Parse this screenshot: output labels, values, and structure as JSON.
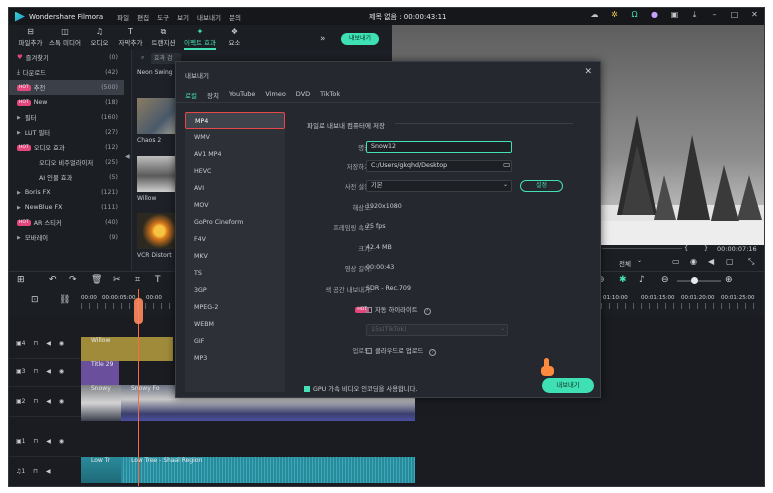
{
  "app": {
    "name": "Wondershare Filmora",
    "menu": [
      "파일",
      "편집",
      "도구",
      "보기",
      "내보내기",
      "문의"
    ],
    "project_title": "제목 없음 : 00:00:43:11"
  },
  "toolbar": {
    "items": [
      {
        "label": "파일추가",
        "icon": "import-icon"
      },
      {
        "label": "스톡 미디어",
        "icon": "stock-media-icon"
      },
      {
        "label": "오디오",
        "icon": "audio-icon"
      },
      {
        "label": "자막추가",
        "icon": "title-icon"
      },
      {
        "label": "트랜지션",
        "icon": "transition-icon"
      },
      {
        "label": "이펙트 효과",
        "icon": "effects-icon"
      },
      {
        "label": "요소",
        "icon": "elements-icon"
      }
    ],
    "export_label": "내보내기"
  },
  "library": {
    "items": [
      {
        "label": "즐겨찾기",
        "count": "(0)"
      },
      {
        "label": "다운로드",
        "count": "(42)"
      },
      {
        "label": "추천",
        "count": "(500)",
        "badge": "HOT",
        "selected": true
      },
      {
        "label": "New",
        "count": "(18)",
        "badge": "HOT"
      },
      {
        "label": "필터",
        "count": "(160)"
      },
      {
        "label": "LUT 필터",
        "count": "(27)"
      },
      {
        "label": "오디오 효과",
        "count": "(12)",
        "badge": "HOT"
      },
      {
        "label": "오디오 비주얼라이저",
        "count": "(25)"
      },
      {
        "label": "AI 인물 효과",
        "count": "(5)"
      },
      {
        "label": "Boris FX",
        "count": "(121)"
      },
      {
        "label": "NewBlue FX",
        "count": "(111)"
      },
      {
        "label": "AR 스티커",
        "count": "(40)",
        "badge": "HOT"
      },
      {
        "label": "모바레이",
        "count": "(9)"
      }
    ]
  },
  "thumbs": {
    "search_placeholder": "효과 검",
    "labels": [
      "Neon Swing",
      "Chaos 2",
      "Willow",
      "VCR Distort"
    ]
  },
  "preview": {
    "time": "00:00:07:16",
    "quality": "전체",
    "brace_left": "{",
    "brace_right": "}"
  },
  "timeline": {
    "ruler_left": [
      "00:00",
      "00:00:05:00",
      "00:00"
    ],
    "ruler_right": [
      "01:10:00",
      "00:01:15:00",
      "00:01:20:00",
      "00:01:25:00"
    ],
    "clips": {
      "willow": "Willow",
      "title": "Title 29",
      "video1": "Snowy",
      "video2": "Snowy Fo",
      "audio1": "Low Tr",
      "audio2": "Low Tree - Shaal Region"
    }
  },
  "dialog": {
    "title": "내보내기",
    "tabs": [
      "로컬",
      "장치",
      "YouTube",
      "Vimeo",
      "DVD",
      "TikTok"
    ],
    "formats": [
      "MP4",
      "WMV",
      "AV1 MP4",
      "HEVC",
      "AVI",
      "MOV",
      "GoPro Cineform",
      "F4V",
      "MKV",
      "TS",
      "3GP",
      "MPEG-2",
      "WEBM",
      "GIF",
      "MP3"
    ],
    "section_title": "파일로 내보내 컴퓨터에 저장",
    "name_label": "명칭:",
    "name_value": "Snow12",
    "save_label": "저장하기:",
    "save_value": "C:/Users/gkqhd/Desktop",
    "preset_label": "사전 설정:",
    "preset_value": "기본",
    "settings_button": "설정",
    "resolution_label": "해상도:",
    "resolution_value": "1920x1080",
    "framerate_label": "프레임링 속도:",
    "framerate_value": "25 fps",
    "size_label": "크기:",
    "size_value": "42.4 MB",
    "duration_label": "영상 길이:",
    "duration_value": "00:00:43",
    "colorspace_label": "색 공간 내보내기:",
    "colorspace_value": "SDR - Rec.709",
    "highlight_badge": "HOT",
    "highlight_label": "자동 하이라이트",
    "highlight_select": "15s(TikTok)",
    "upload_label": "업로드:",
    "upload_value": "클라우드로 업로드",
    "gpu_label": "GPU 가속 비디오 인코딩을 사용합니다.",
    "export_button": "내보내기"
  }
}
